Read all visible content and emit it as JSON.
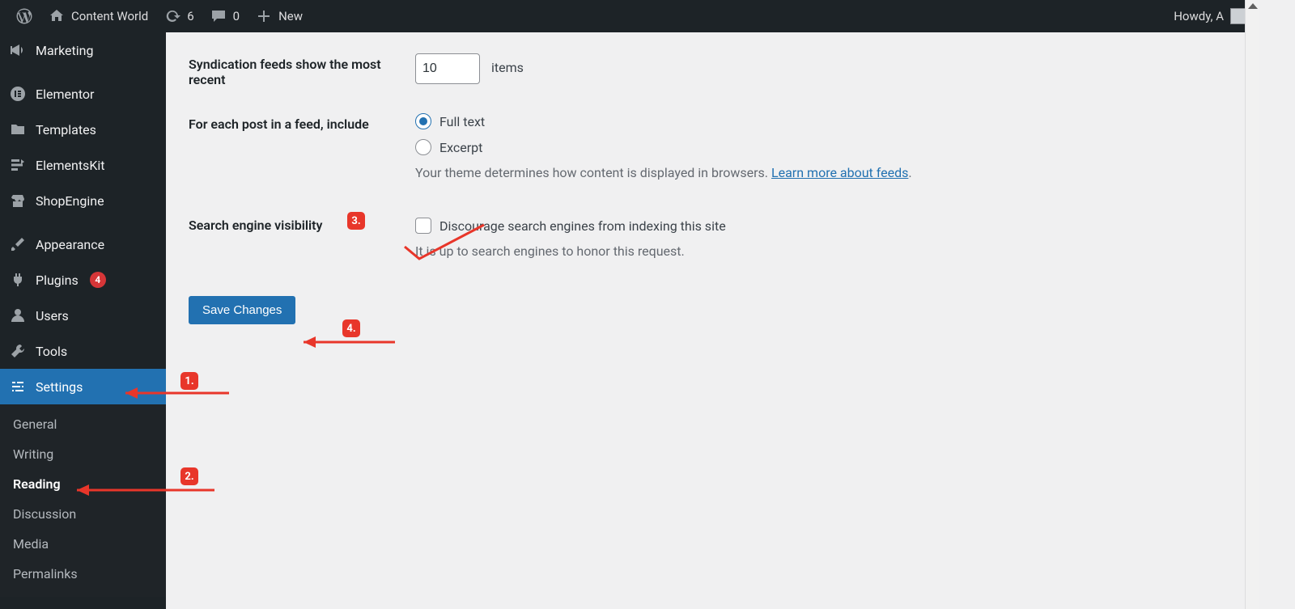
{
  "adminbar": {
    "site_name": "Content World",
    "updates_count": "6",
    "comments_count": "0",
    "new_label": "New",
    "howdy": "Howdy, A"
  },
  "sidebar": {
    "items": [
      {
        "label": "Marketing"
      },
      {
        "label": "Elementor"
      },
      {
        "label": "Templates"
      },
      {
        "label": "ElementsKit"
      },
      {
        "label": "ShopEngine"
      },
      {
        "label": "Appearance"
      },
      {
        "label": "Plugins",
        "badge": "4"
      },
      {
        "label": "Users"
      },
      {
        "label": "Tools"
      },
      {
        "label": "Settings"
      }
    ],
    "submenu": [
      {
        "label": "General"
      },
      {
        "label": "Writing"
      },
      {
        "label": "Reading"
      },
      {
        "label": "Discussion"
      },
      {
        "label": "Media"
      },
      {
        "label": "Permalinks"
      }
    ]
  },
  "settings": {
    "syndication_label": "Syndication feeds show the most recent",
    "syndication_value": "10",
    "syndication_suffix": "items",
    "feed_include_label": "For each post in a feed, include",
    "feed_full_text": "Full text",
    "feed_excerpt": "Excerpt",
    "feed_desc_prefix": "Your theme determines how content is displayed in browsers. ",
    "feed_desc_link": "Learn more about feeds",
    "sev_label": "Search engine visibility",
    "sev_checkbox_label": "Discourage search engines from indexing this site",
    "sev_desc": "It is up to search engines to honor this request.",
    "save_label": "Save Changes"
  },
  "annotations": {
    "b1": "1.",
    "b2": "2.",
    "b3": "3.",
    "b4": "4."
  }
}
